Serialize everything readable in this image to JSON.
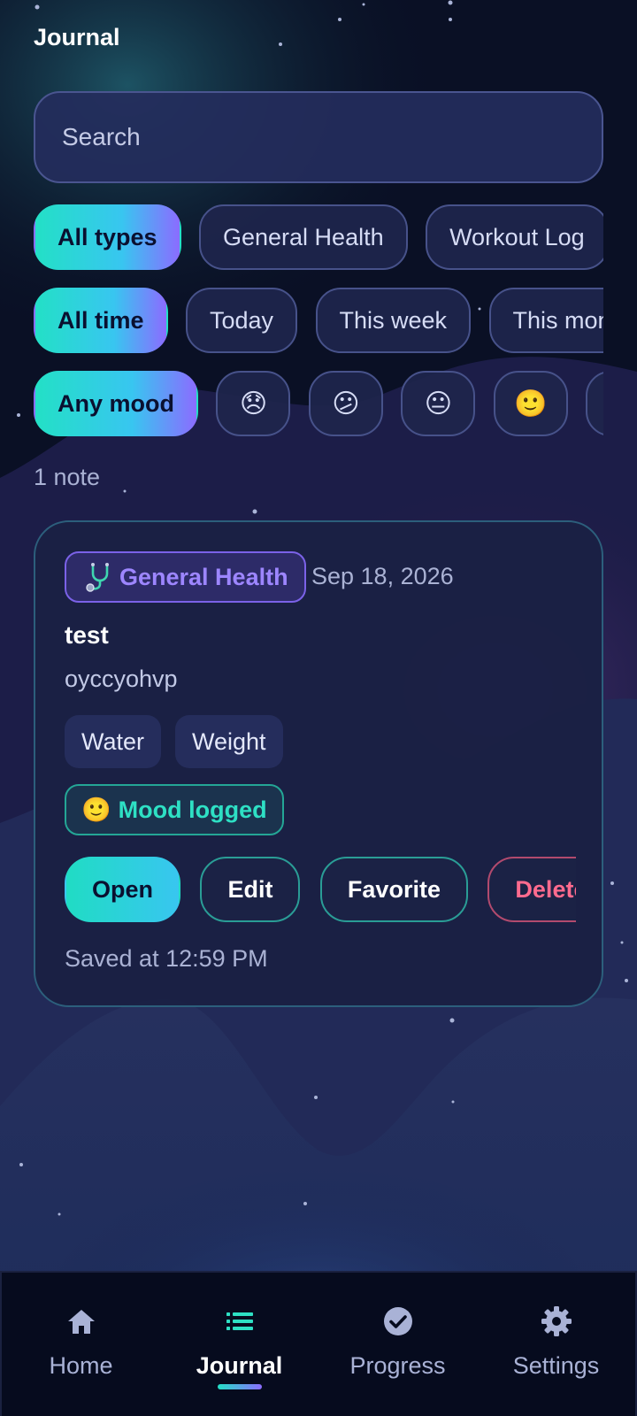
{
  "header": {
    "title": "Journal"
  },
  "search": {
    "placeholder": "Search",
    "value": ""
  },
  "filters": {
    "types": [
      {
        "label": "All types",
        "active": true
      },
      {
        "label": "General Health",
        "active": false
      },
      {
        "label": "Workout Log",
        "active": false
      }
    ],
    "time": [
      {
        "label": "All time",
        "active": true
      },
      {
        "label": "Today",
        "active": false
      },
      {
        "label": "This week",
        "active": false
      },
      {
        "label": "This month",
        "active": false
      }
    ],
    "mood": {
      "any_label": "Any mood",
      "options": [
        "😞",
        "😕",
        "😐",
        "🙂",
        "😄"
      ]
    }
  },
  "results": {
    "count_label": "1 note"
  },
  "note": {
    "category": "General Health",
    "category_icon": "stethoscope-icon",
    "date": "Sep 18, 2026",
    "title": "test",
    "body": "oyccyohvp",
    "tags": [
      "Water",
      "Weight"
    ],
    "mood_badge": {
      "emoji": "🙂",
      "label": "Mood logged"
    },
    "actions": {
      "open": "Open",
      "edit": "Edit",
      "favorite": "Favorite",
      "delete": "Delete"
    },
    "saved": "Saved at 12:59 PM"
  },
  "nav": {
    "active": "journal",
    "items": [
      {
        "id": "home",
        "label": "Home",
        "icon": "home-icon"
      },
      {
        "id": "journal",
        "label": "Journal",
        "icon": "list-icon"
      },
      {
        "id": "progress",
        "label": "Progress",
        "icon": "check-circle-icon"
      },
      {
        "id": "settings",
        "label": "Settings",
        "icon": "gear-icon"
      }
    ]
  },
  "colors": {
    "background": "#0a1025",
    "accent_teal": "#23e0c6",
    "accent_purple": "#8b6cff",
    "danger": "#ff6b8e"
  }
}
